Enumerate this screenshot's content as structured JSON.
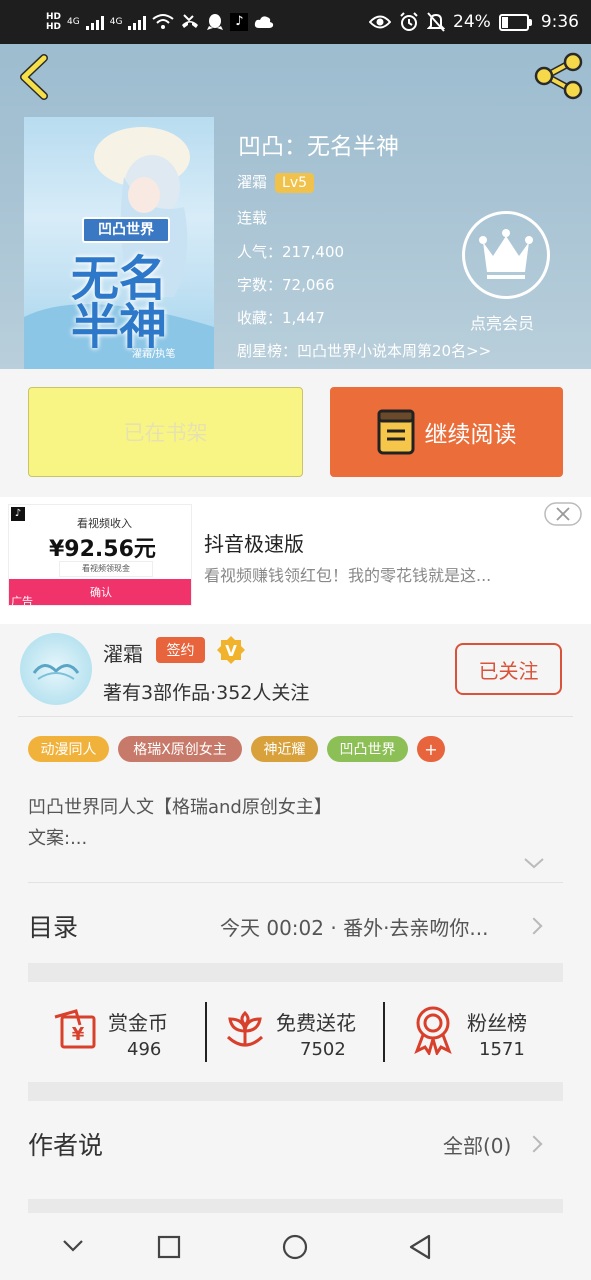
{
  "status": {
    "time": "9:36",
    "battery": "24%",
    "signal1": "4G",
    "signal2": "4G",
    "hd": "HD"
  },
  "book": {
    "title": "凹凸：无名半神",
    "author": "濯霜",
    "level": "Lv5",
    "status": "连载",
    "popularity": "人气：217,400",
    "words": "字数：72,066",
    "favorites": "收藏：1,447",
    "ranking": "剧星榜：凹凸世界小说本周第20名>>",
    "cover_text": {
      "series": "凹凸世界",
      "line1": "无名",
      "line2": "半神",
      "byline": "濯霜/执笔"
    }
  },
  "vip": {
    "label": "点亮会员"
  },
  "actions": {
    "shelf_label": "已在书架",
    "read_label": "继续阅读"
  },
  "ad": {
    "title": "抖音极速版",
    "desc": "看视频赚钱领红包！我的零花钱就是这...",
    "tag": "广告",
    "img_caption": "看视频收入",
    "img_amount": "¥92.56元",
    "img_sub": "看视频领现金",
    "img_button": "确认"
  },
  "author": {
    "name": "濯霜",
    "sign_label": "签约",
    "verified": "V",
    "stats": "著有3部作品·352人关注",
    "follow_label": "已关注"
  },
  "tags": [
    {
      "label": "动漫同人",
      "color": "#f1b23c"
    },
    {
      "label": "格瑞X原创女主",
      "color": "#c87a6a"
    },
    {
      "label": "神近耀",
      "color": "#d8a13c"
    },
    {
      "label": "凹凸世界",
      "color": "#8dbf57"
    },
    {
      "label": "+",
      "color": "#e7643c"
    }
  ],
  "synopsis": {
    "line1": "凹凸世界同人文【格瑞and原创女主】",
    "line2": "文案:..."
  },
  "toc": {
    "title": "目录",
    "latest": "今天 00:02 · 番外·去亲吻你..."
  },
  "stats": [
    {
      "label": "赏金币",
      "value": "496",
      "icon": "red-envelope-icon"
    },
    {
      "label": "免费送花",
      "value": "7502",
      "icon": "flower-icon"
    },
    {
      "label": "粉丝榜",
      "value": "1571",
      "icon": "medal-icon"
    }
  ],
  "author_says": {
    "title": "作者说",
    "all_label": "全部(0)"
  },
  "colors": {
    "accent": "#ea6d3a",
    "shelf": "#f9f585",
    "follow": "#d9533b"
  }
}
